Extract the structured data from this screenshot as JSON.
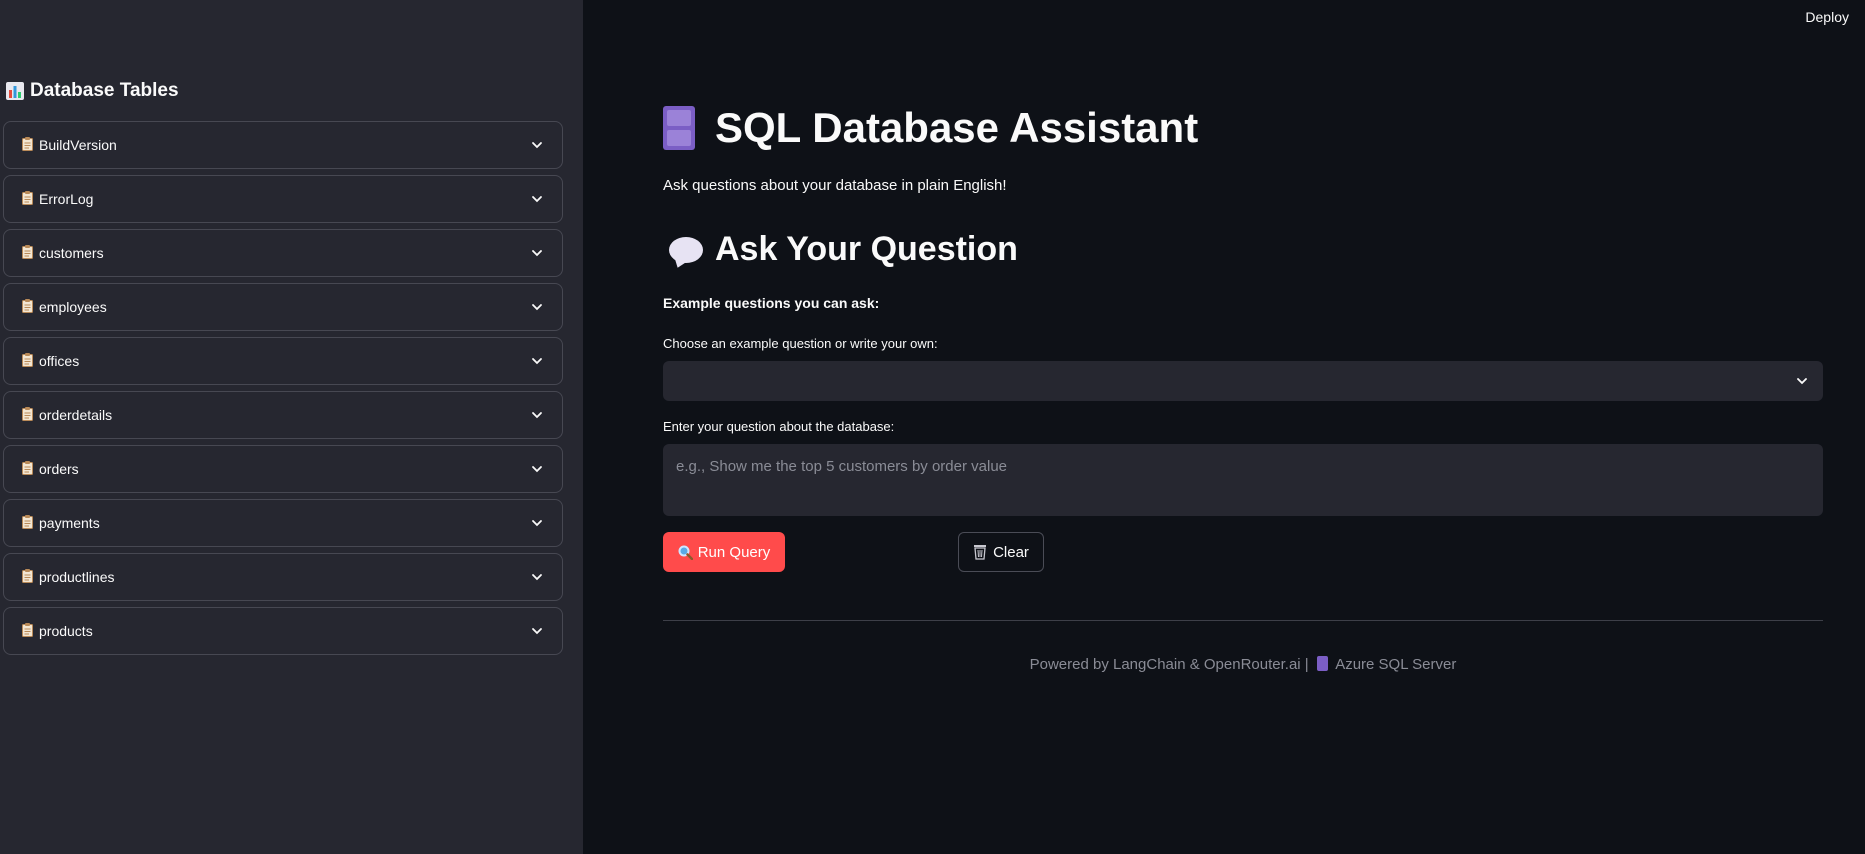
{
  "sidebar": {
    "title": "Database Tables",
    "tables": [
      {
        "label": "BuildVersion"
      },
      {
        "label": "ErrorLog"
      },
      {
        "label": "customers"
      },
      {
        "label": "employees"
      },
      {
        "label": "offices"
      },
      {
        "label": "orderdetails"
      },
      {
        "label": "orders"
      },
      {
        "label": "payments"
      },
      {
        "label": "productlines"
      },
      {
        "label": "products"
      }
    ]
  },
  "header": {
    "deploy_label": "Deploy"
  },
  "main": {
    "title": "SQL Database Assistant",
    "subtitle": "Ask questions about your database in plain English!",
    "section_title": "Ask Your Question",
    "examples_label": "Example questions you can ask:",
    "choose_label": "Choose an example question or write your own:",
    "select_value": "",
    "question_label": "Enter your question about the database:",
    "question_placeholder": "e.g., Show me the top 5 customers by order value",
    "question_value": "",
    "run_label": "Run Query",
    "clear_label": "Clear",
    "footer_prefix": "Powered by LangChain & OpenRouter.ai |",
    "footer_suffix": "Azure SQL Server"
  },
  "colors": {
    "primary": "#ff4b4b",
    "background": "#0e1117",
    "sidebar": "#262730"
  },
  "icons": {
    "sidebar_title": "bar-chart-icon",
    "table": "clipboard-icon",
    "expand": "chevron-down-icon",
    "title": "file-cabinet-icon",
    "section": "speech-bubble-icon",
    "run": "magnifier-icon",
    "clear": "wastebasket-icon"
  }
}
